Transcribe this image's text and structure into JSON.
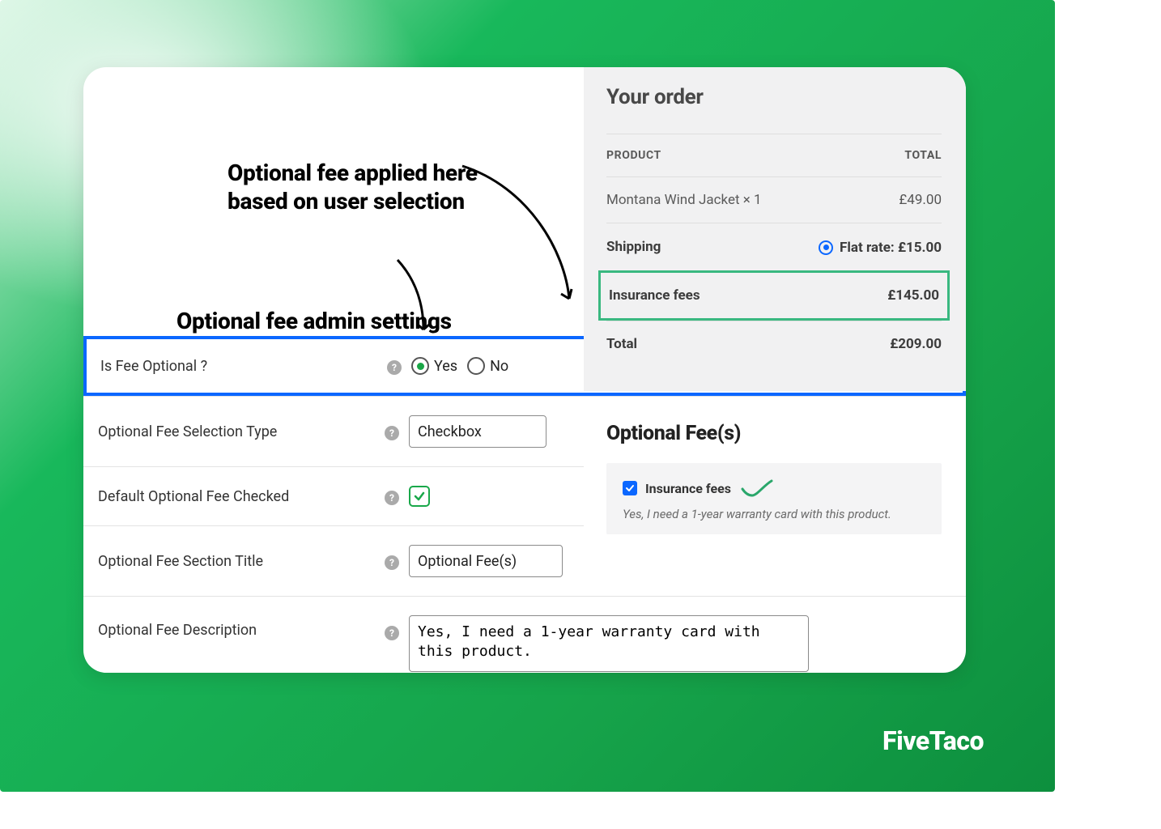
{
  "annotations": {
    "top": "Optional fee applied here\nbased on user selection",
    "mid": "Optional fee admin settings"
  },
  "admin": {
    "is_optional_label": "Is Fee Optional ?",
    "yes": "Yes",
    "no": "No",
    "selection_type_label": "Optional Fee Selection Type",
    "selection_type_value": "Checkbox",
    "default_checked_label": "Default Optional Fee Checked",
    "section_title_label": "Optional Fee Section Title",
    "section_title_value": "Optional Fee(s)",
    "description_label": "Optional Fee Description",
    "description_value": "Yes, I need a 1-year warranty card with this product."
  },
  "order": {
    "title": "Your order",
    "head_product": "Product",
    "head_total": "Total",
    "product_name": "Montana Wind Jacket  × 1",
    "product_total": "£49.00",
    "shipping_label": "Shipping",
    "shipping_value": "Flat rate: £15.00",
    "insurance_label": "Insurance fees",
    "insurance_value": "£145.00",
    "total_label": "Total",
    "total_value": "£209.00"
  },
  "optfee": {
    "heading": "Optional Fee(s)",
    "item_label": "Insurance fees",
    "note": "Yes, I need a 1-year warranty card with this product."
  },
  "brand": "FiveTaco"
}
